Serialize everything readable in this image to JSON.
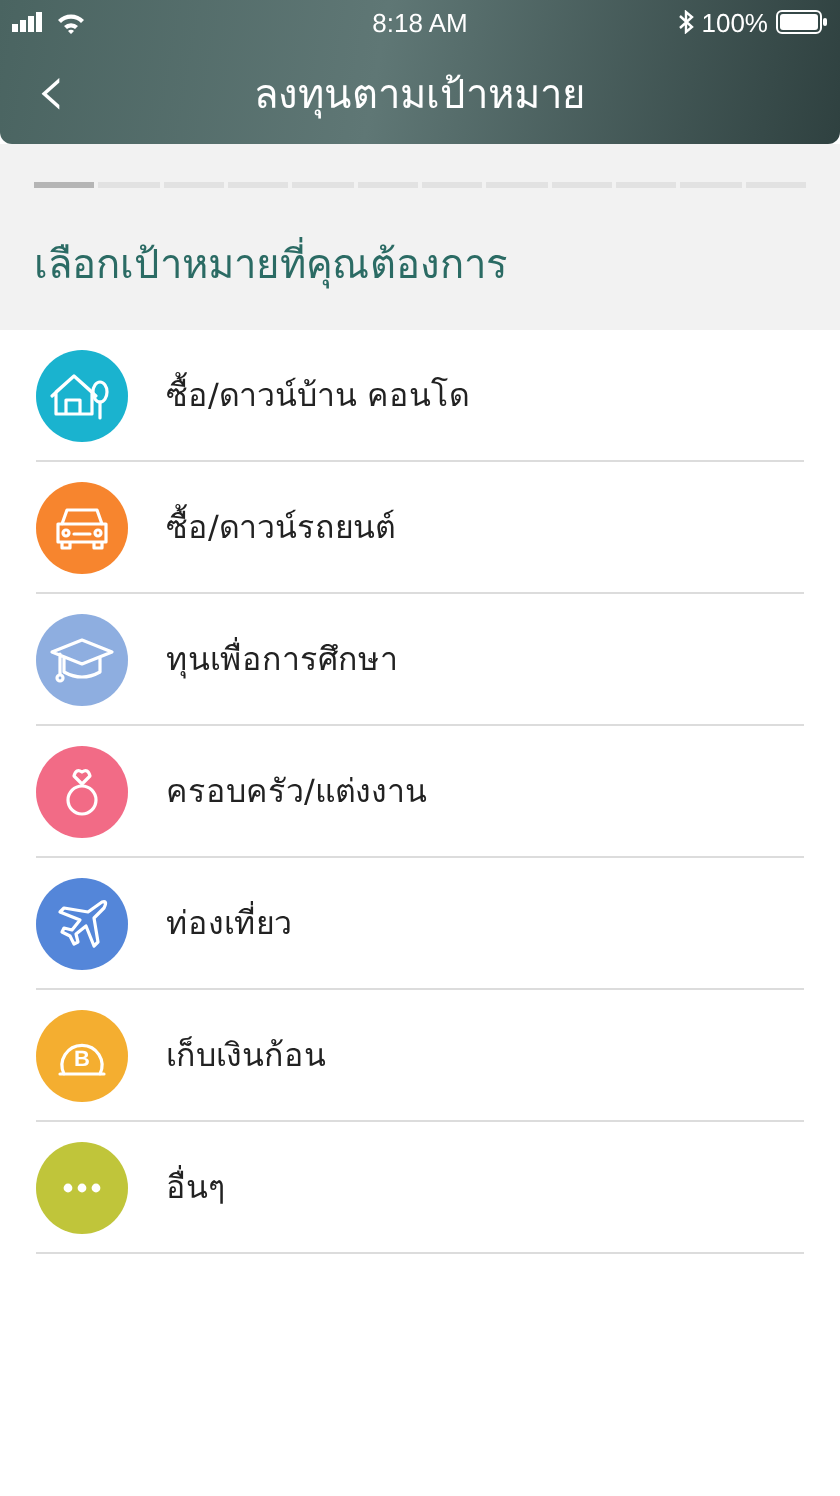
{
  "status_bar": {
    "time": "8:18 AM",
    "battery": "100%"
  },
  "header": {
    "back_icon": "‹",
    "title": "ลงทุนตามเป้าหมาย"
  },
  "progress_steps": [
    {
      "selected": true
    },
    {
      "selected": false
    },
    {
      "selected": false
    },
    {
      "selected": false
    },
    {
      "selected": false
    },
    {
      "selected": false
    },
    {
      "selected": false
    },
    {
      "selected": false
    },
    {
      "selected": false
    },
    {
      "selected": false
    },
    {
      "selected": false
    },
    {
      "selected": false
    }
  ],
  "heading": "เลือกเป้าหมายที่คุณต้องการ",
  "goals": [
    {
      "kind": "house",
      "label": "ซื้อ/ดาวน์บ้าน คอนโด",
      "color": "#1ab3cf"
    },
    {
      "kind": "car",
      "label": "ซื้อ/ดาวน์รถยนต์",
      "color": "#f7852e"
    },
    {
      "kind": "education",
      "label": "ทุนเพื่อการศึกษา",
      "color": "#8eaee0"
    },
    {
      "kind": "ring",
      "label": "ครอบครัว/แต่งงาน",
      "color": "#f26b86"
    },
    {
      "kind": "plane",
      "label": "ท่องเที่ยว",
      "color": "#5486d9"
    },
    {
      "kind": "coin",
      "label": "เก็บเงินก้อน",
      "color": "#f4ae30",
      "glyph": "B"
    },
    {
      "kind": "more",
      "label": "อื่นๆ",
      "color": "#c0c53a"
    }
  ]
}
